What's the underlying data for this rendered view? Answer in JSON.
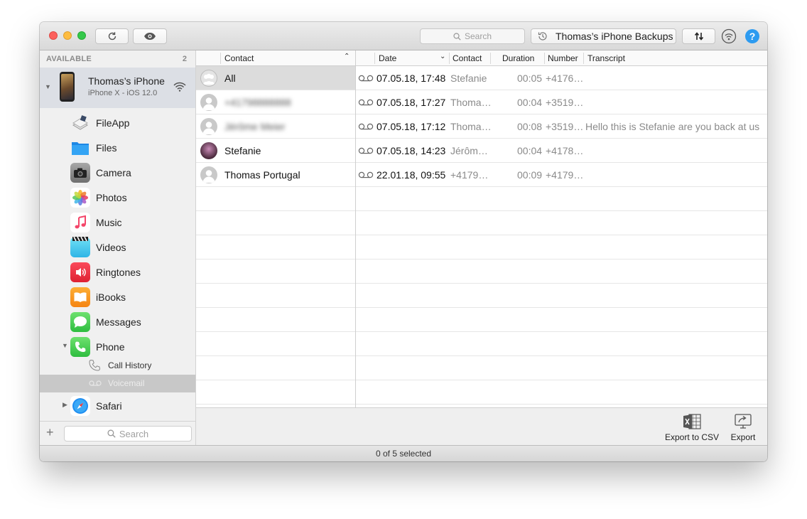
{
  "toolbar": {
    "search_placeholder": "Search",
    "backups_label": "Thomas’s iPhone Backups"
  },
  "sidebar": {
    "header": "AVAILABLE",
    "count": "2",
    "device": {
      "name": "Thomas’s iPhone",
      "subtitle": "iPhone X - iOS 12.0"
    },
    "items": [
      {
        "label": "FileApp",
        "icon": "fileapp-icon"
      },
      {
        "label": "Files",
        "icon": "files-icon"
      },
      {
        "label": "Camera",
        "icon": "camera-icon"
      },
      {
        "label": "Photos",
        "icon": "photos-icon"
      },
      {
        "label": "Music",
        "icon": "music-icon"
      },
      {
        "label": "Videos",
        "icon": "videos-icon"
      },
      {
        "label": "Ringtones",
        "icon": "ringtones-icon"
      },
      {
        "label": "iBooks",
        "icon": "ibooks-icon"
      },
      {
        "label": "Messages",
        "icon": "messages-icon"
      },
      {
        "label": "Phone",
        "icon": "phone-icon"
      }
    ],
    "phone_children": [
      {
        "label": "Call History",
        "icon": "call-history-icon"
      },
      {
        "label": "Voicemail",
        "icon": "voicemail-icon",
        "selected": true
      }
    ],
    "safari": {
      "label": "Safari",
      "icon": "safari-icon"
    },
    "search_placeholder": "Search"
  },
  "contacts": {
    "header": "Contact",
    "rows": [
      {
        "name": "All",
        "selected": true
      },
      {
        "name": "+41798888888",
        "blurred": true
      },
      {
        "name": "Jérôme Meier",
        "blurred": true
      },
      {
        "name": "Stefanie"
      },
      {
        "name": "Thomas Portugal"
      }
    ]
  },
  "voicemails": {
    "columns": [
      "Date",
      "Contact",
      "Duration",
      "Number",
      "Transcript"
    ],
    "rows": [
      {
        "date": "07.05.18, 17:48",
        "contact": "Stefanie",
        "duration": "00:05",
        "number": "+4176…",
        "transcript": ""
      },
      {
        "date": "07.05.18, 17:27",
        "contact": "Thoma…",
        "duration": "00:04",
        "number": "+3519…",
        "transcript": ""
      },
      {
        "date": "07.05.18, 17:12",
        "contact": "Thoma…",
        "duration": "00:08",
        "number": "+3519…",
        "transcript": "Hello this is Stefanie are you back at us"
      },
      {
        "date": "07.05.18, 14:23",
        "contact": "Jérôm…",
        "duration": "00:04",
        "number": "+4178…",
        "transcript": ""
      },
      {
        "date": "22.01.18, 09:55",
        "contact": "+4179…",
        "duration": "00:09",
        "number": "+4179…",
        "transcript": ""
      }
    ]
  },
  "actions": {
    "export_csv": "Export to CSV",
    "export": "Export"
  },
  "status": {
    "text": "0 of 5 selected"
  },
  "colors": {
    "accent_selected": "#dcdfe5",
    "help_blue": "#2d9bf0",
    "close": "#fc605c",
    "minimize": "#fdbc40",
    "zoom": "#34c84a"
  }
}
